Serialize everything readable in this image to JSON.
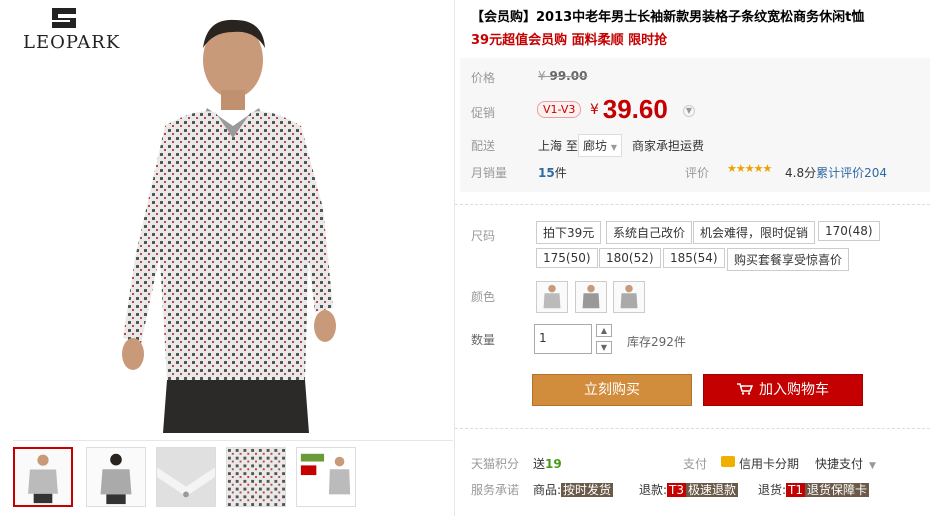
{
  "brand": {
    "name": "LEOPARK"
  },
  "product": {
    "title": "【会员购】2013中老年男士长袖新款男装格子条纹宽松商务休闲t恤",
    "subtitle": "39元超值会员购 面料柔顺 限时抢"
  },
  "price": {
    "label": "价格",
    "currency": "¥",
    "original": "99.00",
    "promo_label": "促销",
    "vip_tag": "V1-V3",
    "promo_price": "39.60"
  },
  "shipping": {
    "label": "配送",
    "from": "上海",
    "to_word": "至",
    "to": "廊坊",
    "note": "商家承担运费"
  },
  "sales": {
    "label": "月销量",
    "count": "15",
    "unit": "件",
    "rating_label": "评价",
    "stars": "★★★★★",
    "score": "4.8分",
    "review_link": "累计评价204"
  },
  "size": {
    "label": "尺码",
    "options": [
      "拍下39元",
      "系统自己改价",
      "机会难得，限时促销",
      "170(48)",
      "175(50)",
      "180(52)",
      "185(54)",
      "购买套餐享受惊喜价"
    ]
  },
  "color": {
    "label": "颜色"
  },
  "quantity": {
    "label": "数量",
    "value": "1",
    "stock": "库存292件"
  },
  "actions": {
    "buy_now": "立刻购买",
    "add_to_cart": "加入购物车"
  },
  "points": {
    "label": "天猫积分",
    "prefix": "送",
    "value": "19"
  },
  "payment": {
    "label": "支付",
    "card": "信用卡分期",
    "quick": "快捷支付"
  },
  "service": {
    "label": "服务承诺",
    "goods_label": "商品:",
    "goods_tag": "按时发货",
    "refund_label": "退款:",
    "refund_code": "T3",
    "refund_tag": "极速退款",
    "return_label": "退货:",
    "return_code": "T1",
    "return_tag": "退货保障卡"
  },
  "colors": {
    "accent_red": "#c40000",
    "buy_orange": "#d18c3c",
    "link_blue": "#2e6aa3"
  }
}
